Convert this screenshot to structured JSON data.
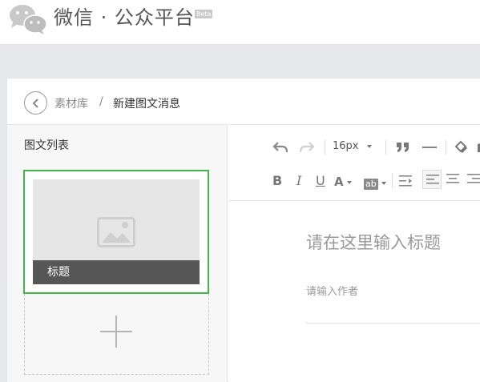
{
  "header": {
    "brand": "微信 · 公众平台",
    "beta": "Beta"
  },
  "breadcrumb": {
    "library": "素材库",
    "separator": "/",
    "current": "新建图文消息"
  },
  "sidebar": {
    "title": "图文列表",
    "articles": [
      {
        "title": "标题",
        "selected": true
      }
    ]
  },
  "toolbar": {
    "font_size": "16px",
    "font_color_label": "A",
    "highlight_label": "ab",
    "bold_label": "B",
    "italic_label": "I",
    "underline_label": "U"
  },
  "editor": {
    "title_placeholder": "请在这里输入标题",
    "author_placeholder": "请输入作者"
  },
  "colors": {
    "accent": "#44b549",
    "background": "#e7e8eb"
  }
}
